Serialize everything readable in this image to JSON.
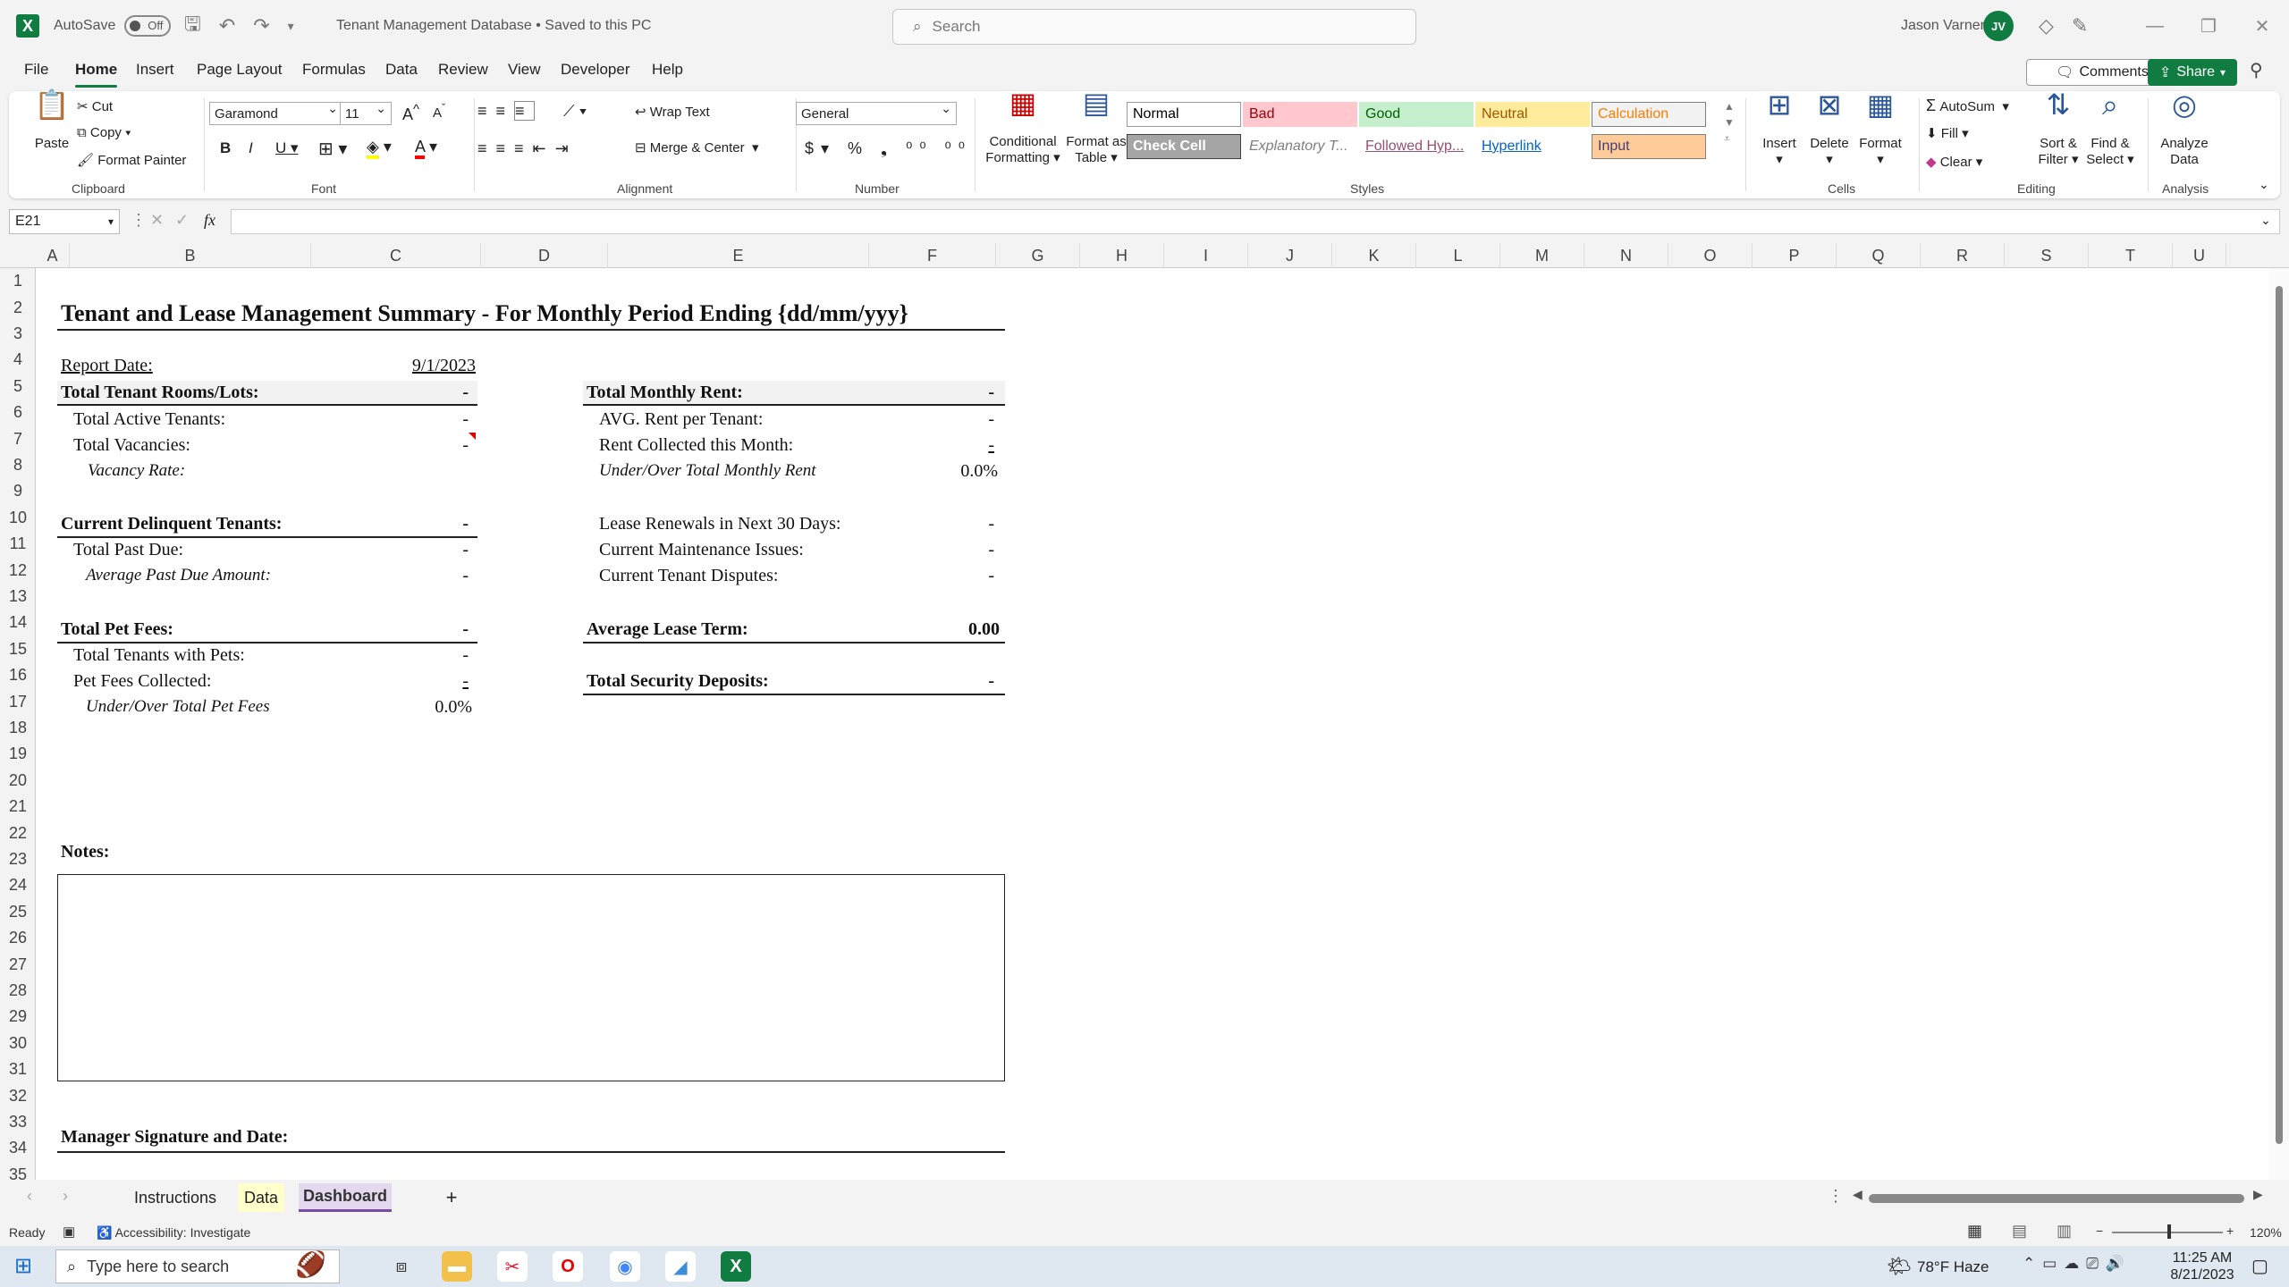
{
  "titlebar": {
    "autosave_label": "AutoSave",
    "autosave_state": "Off",
    "doc_title": "Tenant Management Database • Saved to this PC",
    "search_placeholder": "Search",
    "user_name": "Jason Varner",
    "user_initials": "JV"
  },
  "menu": {
    "items": [
      "File",
      "Home",
      "Insert",
      "Page Layout",
      "Formulas",
      "Data",
      "Review",
      "View",
      "Developer",
      "Help"
    ],
    "active": "Home",
    "comments_label": "Comments",
    "share_label": "Share"
  },
  "ribbon": {
    "paste": "Paste",
    "cut": "Cut",
    "copy": "Copy",
    "format_painter": "Format Painter",
    "clipboard": "Clipboard",
    "font_name": "Garamond",
    "font_size": "11",
    "font": "Font",
    "wrap_text": "Wrap Text",
    "merge_center": "Merge & Center",
    "alignment": "Alignment",
    "number_format": "General",
    "number": "Number",
    "conditional_formatting": [
      "Conditional",
      "Formatting"
    ],
    "format_as_table": [
      "Format as",
      "Table"
    ],
    "styles": "Styles",
    "style_cells": [
      {
        "label": "Normal",
        "bg": "#ffffff",
        "fg": "#000000",
        "border": "#999999"
      },
      {
        "label": "Bad",
        "bg": "#ffc7ce",
        "fg": "#9c0006",
        "border": "#ffc7ce"
      },
      {
        "label": "Good",
        "bg": "#c6efce",
        "fg": "#006100",
        "border": "#c6efce"
      },
      {
        "label": "Neutral",
        "bg": "#ffeb9c",
        "fg": "#9c5700",
        "border": "#ffeb9c"
      },
      {
        "label": "Calculation",
        "bg": "#f2f2f2",
        "fg": "#fa7d00",
        "border": "#7f7f7f"
      },
      {
        "label": "Check Cell",
        "bg": "#a5a5a5",
        "fg": "#ffffff",
        "border": "#3f3f3f"
      },
      {
        "label": "Explanatory T...",
        "bg": "#ffffff",
        "fg": "#7f7f7f",
        "border": "#ffffff"
      },
      {
        "label": "Followed Hyp...",
        "bg": "#ffffff",
        "fg": "#954f72",
        "border": "#ffffff"
      },
      {
        "label": "Hyperlink",
        "bg": "#ffffff",
        "fg": "#0563c1",
        "border": "#ffffff"
      },
      {
        "label": "Input",
        "bg": "#ffcc99",
        "fg": "#3f3f76",
        "border": "#7f7f7f"
      }
    ],
    "insert": "Insert",
    "delete": "Delete",
    "format": "Format",
    "cells": "Cells",
    "autosum": "AutoSum",
    "fill": "Fill",
    "clear": "Clear",
    "sort_filter": [
      "Sort &",
      "Filter"
    ],
    "find_select": [
      "Find &",
      "Select"
    ],
    "editing": "Editing",
    "analyze_data": [
      "Analyze",
      "Data"
    ],
    "analysis": "Analysis"
  },
  "formula_bar": {
    "name_box": "E21",
    "fx": "fx",
    "value": ""
  },
  "grid": {
    "columns": [
      "A",
      "B",
      "C",
      "D",
      "E",
      "F",
      "G",
      "H",
      "I",
      "J",
      "K",
      "L",
      "M",
      "N",
      "O",
      "P",
      "Q",
      "R",
      "S",
      "T",
      "U"
    ],
    "rows": [
      "1",
      "2",
      "3",
      "4",
      "5",
      "6",
      "7",
      "8",
      "9",
      "10",
      "11",
      "12",
      "13",
      "14",
      "15",
      "16",
      "17",
      "18",
      "19",
      "20",
      "21",
      "22",
      "23",
      "24",
      "25",
      "26",
      "27",
      "28",
      "29",
      "30",
      "31",
      "32",
      "33",
      "34",
      "35"
    ]
  },
  "sheet": {
    "title": "Tenant and Lease Management Summary -  For Monthly Period Ending {dd/mm/yyy}",
    "report_date_label": "Report Date:",
    "report_date_value": "9/1/2023",
    "total_rooms_label": "Total Tenant Rooms/Lots:",
    "total_rooms_value": "-",
    "active_tenants_label": "Total Active Tenants:",
    "active_tenants_value": "-",
    "vacancies_label": "Total Vacancies:",
    "vacancies_value": "-",
    "vacancy_rate_label": "Vacancy Rate:",
    "delinquent_label": "Current Delinquent Tenants:",
    "delinquent_value": "-",
    "past_due_label": "Total Past Due:",
    "past_due_value": "-",
    "avg_past_due_label": "Average Past Due Amount:",
    "avg_past_due_value": "-",
    "pet_fees_label": "Total Pet Fees:",
    "pet_fees_value": "-",
    "tenants_pets_label": "Total Tenants with Pets:",
    "tenants_pets_value": "-",
    "pet_fees_collected_label": "Pet Fees Collected:",
    "pet_fees_collected_value": "-",
    "under_over_pet_label": "Under/Over Total Pet Fees",
    "under_over_pet_value": "0.0%",
    "monthly_rent_label": "Total Monthly Rent:",
    "monthly_rent_value": "-",
    "avg_rent_label": "AVG. Rent per Tenant:",
    "avg_rent_value": "-",
    "rent_collected_label": "Rent Collected this Month:",
    "rent_collected_value": "-",
    "under_over_rent_label": "Under/Over Total Monthly Rent",
    "under_over_rent_value": "0.0%",
    "renewals_label": "Lease Renewals in Next 30 Days:",
    "renewals_value": "-",
    "maintenance_label": "Current Maintenance Issues:",
    "maintenance_value": "-",
    "disputes_label": "Current Tenant Disputes:",
    "disputes_value": "-",
    "avg_lease_label": "Average Lease Term:",
    "avg_lease_value": "0.00",
    "security_label": "Total Security Deposits:",
    "security_value": "-",
    "notes_label": "Notes:",
    "signature_label": "Manager Signature and Date:"
  },
  "tabs": {
    "items": [
      "Instructions",
      "Data",
      "Dashboard"
    ],
    "active": "Dashboard",
    "add": "+"
  },
  "status": {
    "ready": "Ready",
    "accessibility": "Accessibility: Investigate",
    "zoom": "120%"
  },
  "taskbar": {
    "search_placeholder": "Type here to search",
    "weather": "78°F  Haze",
    "time": "11:25 AM",
    "date": "8/21/2023"
  }
}
